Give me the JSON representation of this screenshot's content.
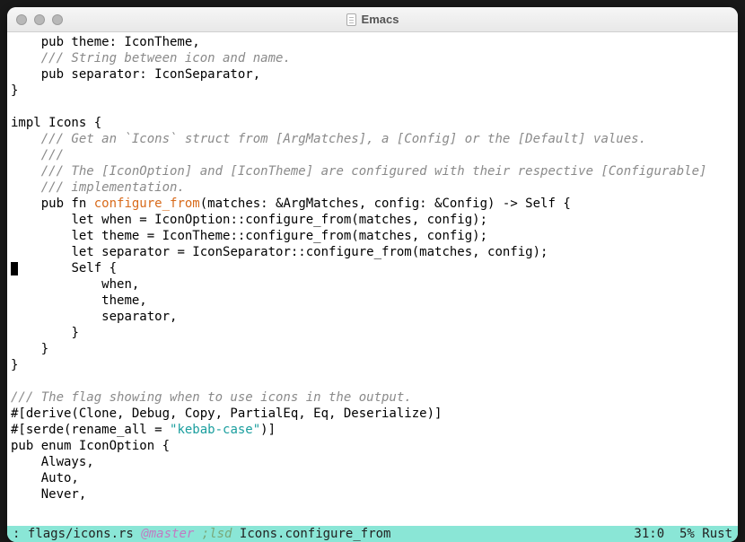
{
  "window": {
    "title": "Emacs"
  },
  "code": {
    "lines": [
      {
        "indent": 4,
        "segs": [
          {
            "t": "pub theme: IconTheme,",
            "c": ""
          }
        ]
      },
      {
        "indent": 4,
        "segs": [
          {
            "t": "/// String between icon and name.",
            "c": "doc"
          }
        ]
      },
      {
        "indent": 4,
        "segs": [
          {
            "t": "pub separator: IconSeparator,",
            "c": ""
          }
        ]
      },
      {
        "indent": 0,
        "segs": [
          {
            "t": "}",
            "c": ""
          }
        ]
      },
      {
        "indent": 0,
        "segs": [
          {
            "t": "",
            "c": ""
          }
        ]
      },
      {
        "indent": 0,
        "segs": [
          {
            "t": "impl Icons {",
            "c": ""
          }
        ]
      },
      {
        "indent": 4,
        "segs": [
          {
            "t": "/// Get an `Icons` struct from [ArgMatches], a [Config] or the [Default] values.",
            "c": "doc"
          }
        ]
      },
      {
        "indent": 4,
        "segs": [
          {
            "t": "///",
            "c": "doc"
          }
        ]
      },
      {
        "indent": 4,
        "segs": [
          {
            "t": "/// The [IconOption] and [IconTheme] are configured with their respective [Configurable]",
            "c": "doc"
          }
        ]
      },
      {
        "indent": 4,
        "segs": [
          {
            "t": "/// implementation.",
            "c": "doc"
          }
        ]
      },
      {
        "indent": 4,
        "segs": [
          {
            "t": "pub fn ",
            "c": ""
          },
          {
            "t": "configure_from",
            "c": "fn-name"
          },
          {
            "t": "(matches: &ArgMatches, config: &Config) -> Self {",
            "c": ""
          }
        ]
      },
      {
        "indent": 8,
        "segs": [
          {
            "t": "let when = IconOption::configure_from(matches, config);",
            "c": ""
          }
        ]
      },
      {
        "indent": 8,
        "segs": [
          {
            "t": "let theme = IconTheme::configure_from(matches, config);",
            "c": ""
          }
        ]
      },
      {
        "indent": 8,
        "segs": [
          {
            "t": "let separator = IconSeparator::configure_from(matches, config);",
            "c": ""
          }
        ]
      },
      {
        "indent": 8,
        "segs": [
          {
            "t": "Self {",
            "c": ""
          }
        ],
        "cursor_before": true
      },
      {
        "indent": 12,
        "segs": [
          {
            "t": "when,",
            "c": ""
          }
        ]
      },
      {
        "indent": 12,
        "segs": [
          {
            "t": "theme,",
            "c": ""
          }
        ]
      },
      {
        "indent": 12,
        "segs": [
          {
            "t": "separator,",
            "c": ""
          }
        ]
      },
      {
        "indent": 8,
        "segs": [
          {
            "t": "}",
            "c": ""
          }
        ]
      },
      {
        "indent": 4,
        "segs": [
          {
            "t": "}",
            "c": ""
          }
        ]
      },
      {
        "indent": 0,
        "segs": [
          {
            "t": "}",
            "c": ""
          }
        ]
      },
      {
        "indent": 0,
        "segs": [
          {
            "t": "",
            "c": ""
          }
        ]
      },
      {
        "indent": 0,
        "segs": [
          {
            "t": "/// The flag showing when to use icons in the output.",
            "c": "doc"
          }
        ]
      },
      {
        "indent": 0,
        "segs": [
          {
            "t": "#[derive(Clone, Debug, Copy, PartialEq, Eq, Deserialize)]",
            "c": ""
          }
        ]
      },
      {
        "indent": 0,
        "segs": [
          {
            "t": "#[serde(rename_all = ",
            "c": ""
          },
          {
            "t": "\"kebab-case\"",
            "c": "str"
          },
          {
            "t": ")]",
            "c": ""
          }
        ]
      },
      {
        "indent": 0,
        "segs": [
          {
            "t": "pub enum IconOption {",
            "c": ""
          }
        ]
      },
      {
        "indent": 4,
        "segs": [
          {
            "t": "Always,",
            "c": ""
          }
        ]
      },
      {
        "indent": 4,
        "segs": [
          {
            "t": "Auto,",
            "c": ""
          }
        ]
      },
      {
        "indent": 4,
        "segs": [
          {
            "t": "Never,",
            "c": ""
          }
        ]
      }
    ]
  },
  "modeline": {
    "prefix": ": ",
    "path": "flags/icons.rs",
    "vc": "@master",
    "project_sep": " ;",
    "project": "lsd",
    "which_func": " Icons.configure_from",
    "position": "31:0",
    "percent": "5%",
    "mode": "Rust"
  }
}
